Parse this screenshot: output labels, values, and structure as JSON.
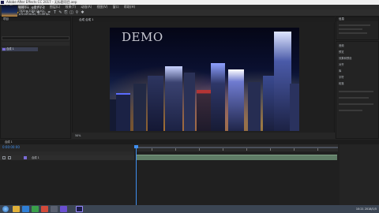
{
  "window": {
    "title": "Adobe After Effects CC 2017 - 无标题项目.aep"
  },
  "menu": [
    "文件(F)",
    "编辑(E)",
    "合成(C)",
    "图层(L)",
    "效果(T)",
    "动画(A)",
    "视图(V)",
    "窗口",
    "帮助(H)"
  ],
  "project_panel": {
    "tab_label": "项目",
    "info_lines": [
      "合成 1 ▾ , 使用了 1 次",
      "1920 x 1080 (1.00)",
      "Δ 0:00:30:00, 25.00 fps"
    ],
    "item_name": "合成 1"
  },
  "composition_panel": {
    "tab_label": "合成 合成 1",
    "overlay_text": "DEMO",
    "zoom_label": "50%"
  },
  "timeline": {
    "tab_label": "合成 1",
    "timecode": "0:00:00:00",
    "layer_name": "合成 1"
  },
  "right_panels": {
    "labels": [
      "信息",
      "音频",
      "预览",
      "效果和预设",
      "对齐",
      "库",
      "字符",
      "段落"
    ]
  },
  "taskbar": {
    "time": "10:21",
    "date": "2018/1/5"
  },
  "colors": {
    "accent": "#3f8ff0",
    "layer_bar": "#5f7c66",
    "taskbar": "#3b4553"
  }
}
